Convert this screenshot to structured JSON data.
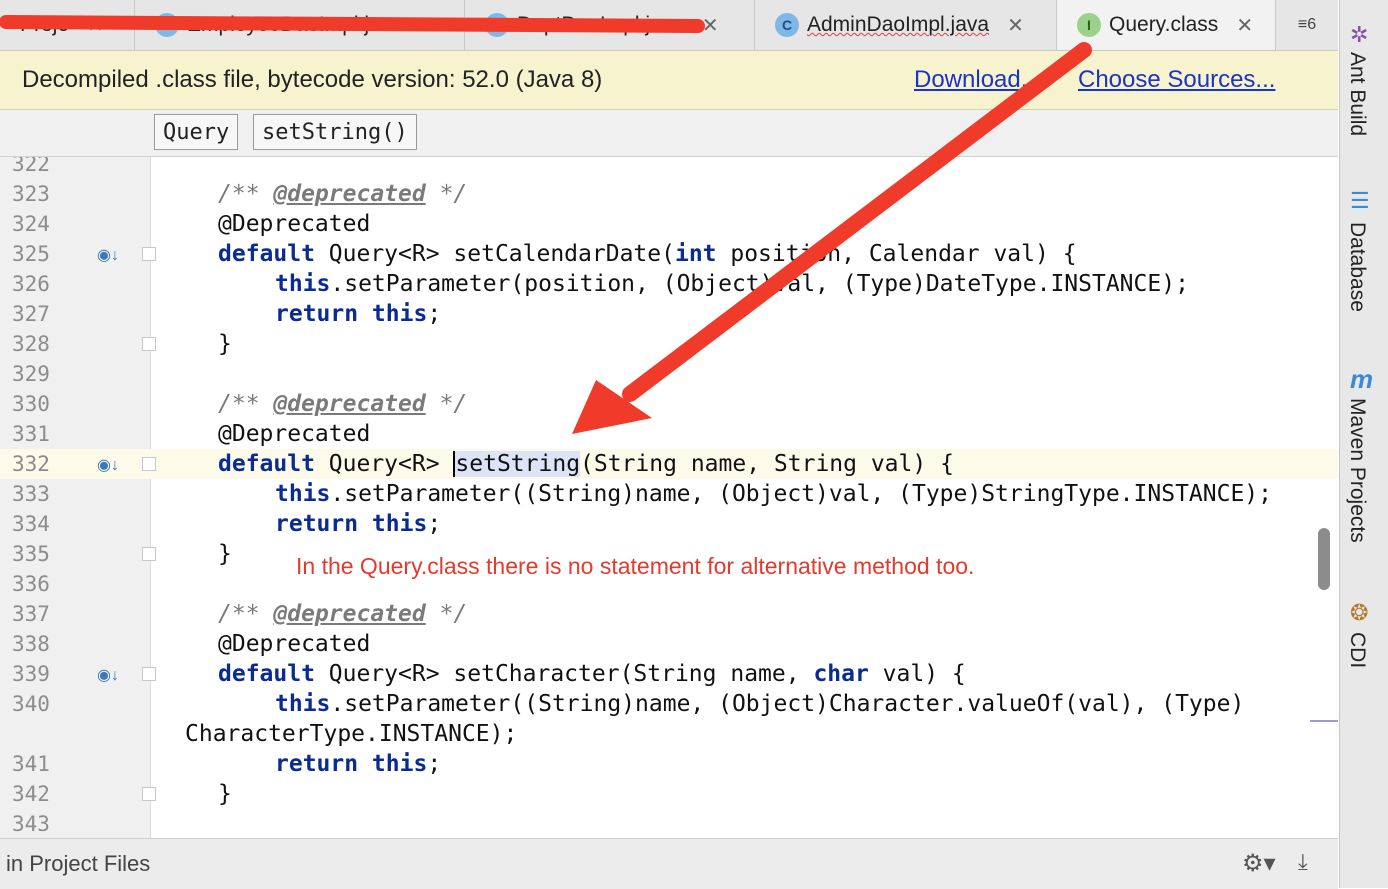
{
  "tabs": [
    {
      "label": "Proje",
      "icon": "",
      "active": false
    },
    {
      "label": "EmployeeDaoImpl.java",
      "icon": "C",
      "active": false
    },
    {
      "label": "DeptDaoImpl.java",
      "icon": "C",
      "active": false
    },
    {
      "label": "AdminDaoImpl.java",
      "icon": "C",
      "active": false
    },
    {
      "label": "Query.class",
      "icon": "I",
      "active": true
    }
  ],
  "tab_overflow": "≡6",
  "banner": {
    "message": "Decompiled .class file, bytecode version: 52.0 (Java 8)",
    "download": "Download...",
    "choose_sources": "Choose Sources..."
  },
  "breadcrumb": [
    "Query",
    "setString()"
  ],
  "code_lines": [
    {
      "num": "322",
      "text": ""
    },
    {
      "num": "323",
      "text": "/** @deprecated */"
    },
    {
      "num": "324",
      "text": "@Deprecated"
    },
    {
      "num": "325",
      "text": "default Query<R> setCalendarDate(int position, Calendar val) {"
    },
    {
      "num": "326",
      "text": "this.setParameter(position, (Object)val, (Type)DateType.INSTANCE);"
    },
    {
      "num": "327",
      "text": "return this;"
    },
    {
      "num": "328",
      "text": "}"
    },
    {
      "num": "329",
      "text": ""
    },
    {
      "num": "330",
      "text": "/** @deprecated */"
    },
    {
      "num": "331",
      "text": "@Deprecated"
    },
    {
      "num": "332",
      "text": "default Query<R> setString(String name, String val) {"
    },
    {
      "num": "333",
      "text": "this.setParameter((String)name, (Object)val, (Type)StringType.INSTANCE);"
    },
    {
      "num": "334",
      "text": "return this;"
    },
    {
      "num": "335",
      "text": "}"
    },
    {
      "num": "336",
      "text": ""
    },
    {
      "num": "337",
      "text": "/** @deprecated */"
    },
    {
      "num": "338",
      "text": "@Deprecated"
    },
    {
      "num": "339",
      "text": "default Query<R> setCharacter(String name, char val) {"
    },
    {
      "num": "340",
      "text": "this.setParameter((String)name, (Object)Character.valueOf(val), (Type)"
    },
    {
      "num": "",
      "text": "CharacterType.INSTANCE);"
    },
    {
      "num": "341",
      "text": "return this;"
    },
    {
      "num": "342",
      "text": "}"
    },
    {
      "num": "343",
      "text": ""
    }
  ],
  "annotation_note": "In the Query.class there is no statement for alternative method too.",
  "status": {
    "text": "in Project Files"
  },
  "tool_windows": [
    "Ant Build",
    "Database",
    "Maven Projects",
    "CDI"
  ],
  "colors": {
    "keyword": "#0a2b8f",
    "banner_bg": "#f7f3cf",
    "link": "#1a33c9",
    "arrow": "#f03a2a",
    "note": "#e23b2e"
  },
  "icons": [
    "close-icon",
    "class-icon",
    "interface-icon",
    "implementing-method-icon",
    "fold-icon",
    "gear-icon",
    "download-icon",
    "ant-icon",
    "database-icon",
    "maven-icon",
    "cdi-icon"
  ]
}
